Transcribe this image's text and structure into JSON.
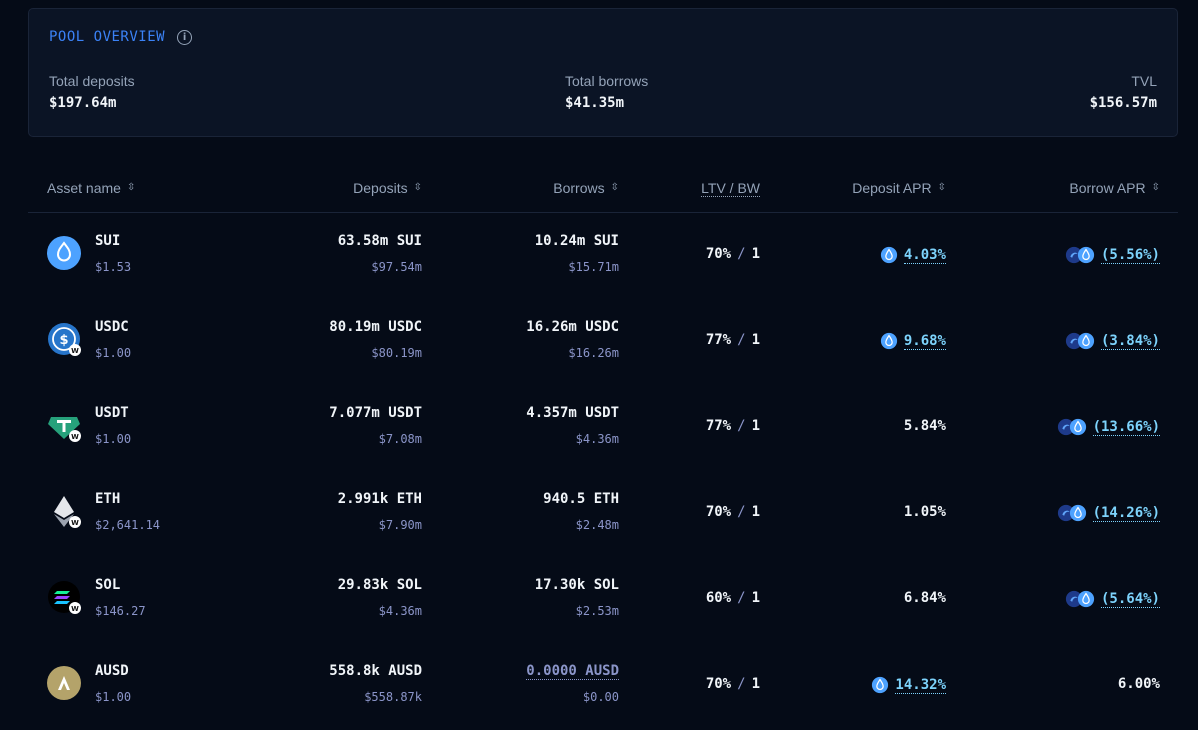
{
  "overview": {
    "title": "POOL OVERVIEW",
    "stats": [
      {
        "label": "Total deposits",
        "value": "$197.64m"
      },
      {
        "label": "Total borrows",
        "value": "$41.35m"
      },
      {
        "label": "TVL",
        "value": "$156.57m"
      }
    ]
  },
  "table": {
    "headers": {
      "asset": "Asset name",
      "deposits": "Deposits",
      "borrows": "Borrows",
      "ltv": "LTV / BW",
      "deposit_apr": "Deposit APR",
      "borrow_apr": "Borrow APR"
    },
    "rows": [
      {
        "name": "SUI",
        "price": "$1.53",
        "deposits": "63.58m SUI",
        "deposits_usd": "$97.54m",
        "borrows": "10.24m SUI",
        "borrows_usd": "$15.71m",
        "ltv": "70%",
        "bw": "1",
        "deposit_apr": "4.03%",
        "borrow_apr": "(5.56%)",
        "icon": "sui-icon",
        "color": "#4da2ff"
      },
      {
        "name": "USDC",
        "price": "$1.00",
        "deposits": "80.19m USDC",
        "deposits_usd": "$80.19m",
        "borrows": "16.26m USDC",
        "borrows_usd": "$16.26m",
        "ltv": "77%",
        "bw": "1",
        "deposit_apr": "9.68%",
        "borrow_apr": "(3.84%)",
        "icon": "usdc-icon",
        "color": "#2775ca"
      },
      {
        "name": "USDT",
        "price": "$1.00",
        "deposits": "7.077m USDT",
        "deposits_usd": "$7.08m",
        "borrows": "4.357m USDT",
        "borrows_usd": "$4.36m",
        "ltv": "77%",
        "bw": "1",
        "deposit_apr": "5.84%",
        "borrow_apr": "(13.66%)",
        "icon": "usdt-icon",
        "color": "#26a17b"
      },
      {
        "name": "ETH",
        "price": "$2,641.14",
        "deposits": "2.991k ETH",
        "deposits_usd": "$7.90m",
        "borrows": "940.5 ETH",
        "borrows_usd": "$2.48m",
        "ltv": "70%",
        "bw": "1",
        "deposit_apr": "1.05%",
        "borrow_apr": "(14.26%)",
        "icon": "eth-icon",
        "color": "#ffffff"
      },
      {
        "name": "SOL",
        "price": "$146.27",
        "deposits": "29.83k SOL",
        "deposits_usd": "$4.36m",
        "borrows": "17.30k SOL",
        "borrows_usd": "$2.53m",
        "ltv": "60%",
        "bw": "1",
        "deposit_apr": "6.84%",
        "borrow_apr": "(5.64%)",
        "icon": "sol-icon",
        "color": "#000000"
      },
      {
        "name": "AUSD",
        "price": "$1.00",
        "deposits": "558.8k AUSD",
        "deposits_usd": "$558.87k",
        "borrows": "0.0000 AUSD",
        "borrows_usd": "$0.00",
        "ltv": "70%",
        "bw": "1",
        "deposit_apr": "14.32%",
        "borrow_apr": "6.00%",
        "icon": "ausd-icon",
        "color": "#b4a36a"
      }
    ]
  }
}
